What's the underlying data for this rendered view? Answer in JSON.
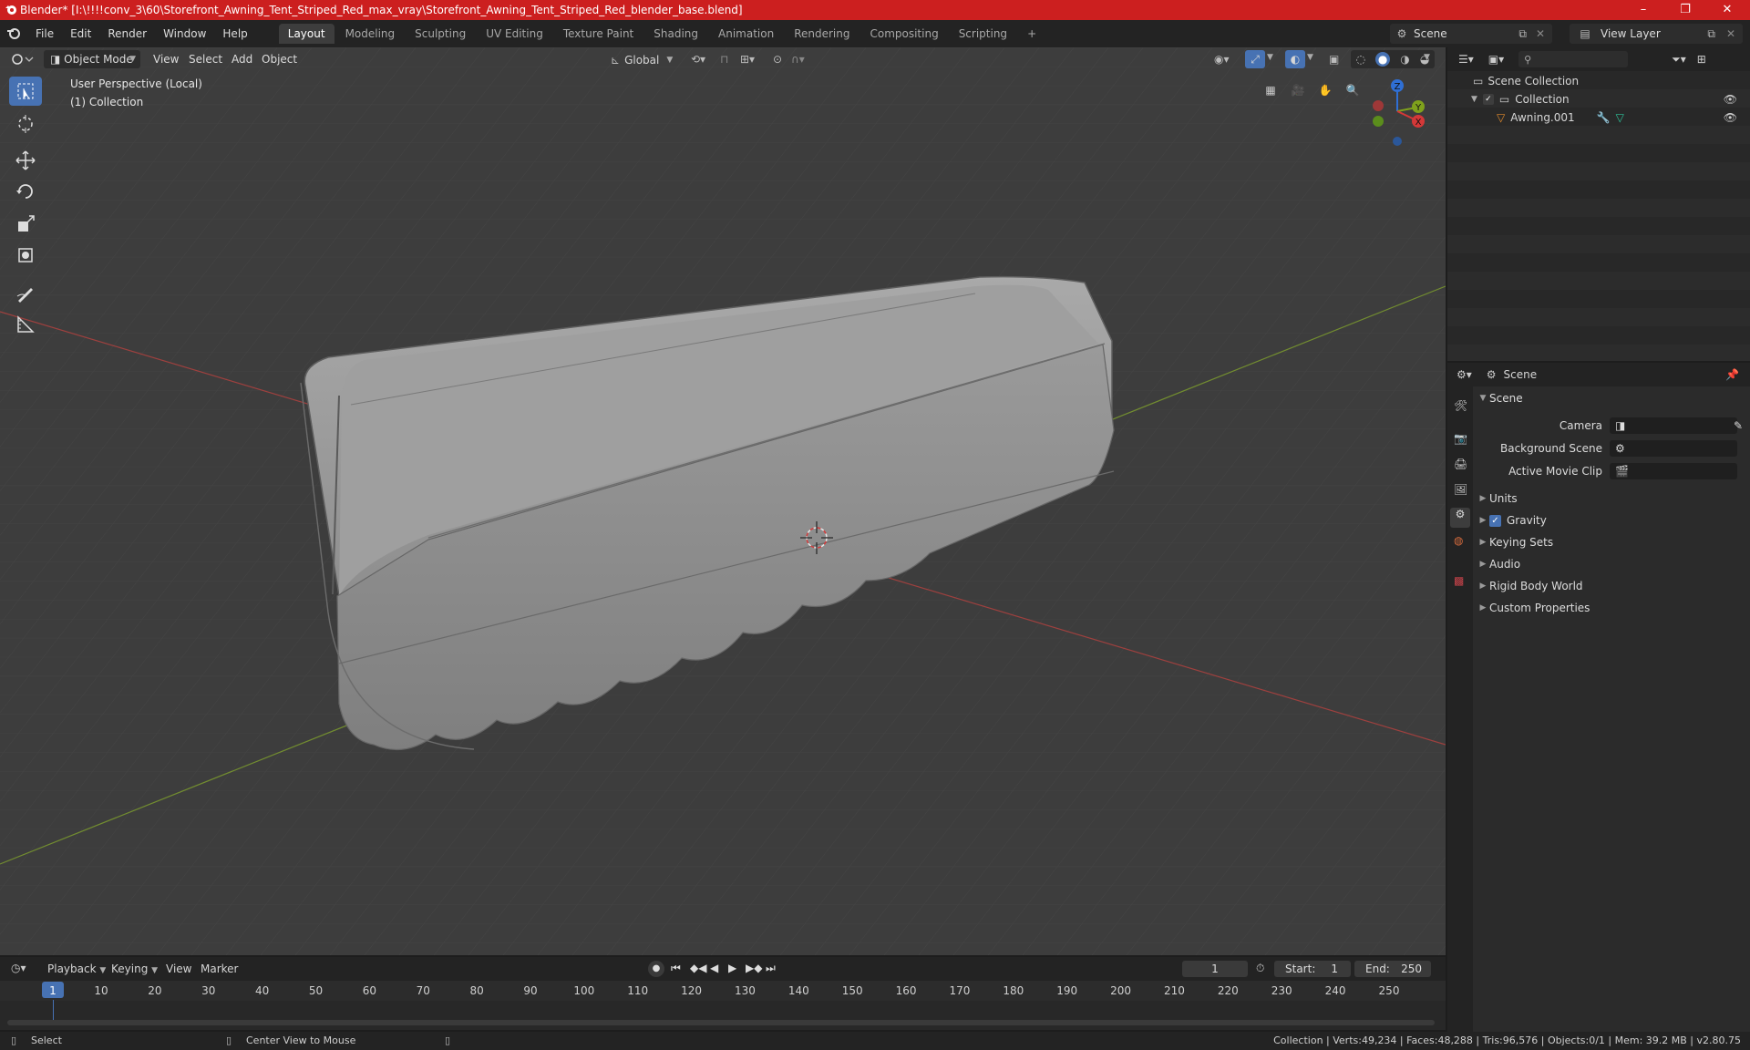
{
  "window": {
    "title": "Blender* [I:\\!!!!conv_3\\60\\Storefront_Awning_Tent_Striped_Red_max_vray\\Storefront_Awning_Tent_Striped_Red_blender_base.blend]",
    "minimize": "–",
    "maximize": "❐",
    "close": "✕"
  },
  "menu": [
    "File",
    "Edit",
    "Render",
    "Window",
    "Help"
  ],
  "workspaces": [
    "Layout",
    "Modeling",
    "Sculpting",
    "UV Editing",
    "Texture Paint",
    "Shading",
    "Animation",
    "Rendering",
    "Compositing",
    "Scripting"
  ],
  "workspace_add": "+",
  "scene_selector": {
    "label": "Scene"
  },
  "view_layer": {
    "label": "View Layer"
  },
  "viewport": {
    "mode": "Object Mode",
    "menus": [
      "View",
      "Select",
      "Add",
      "Object"
    ],
    "orientation": "Global",
    "overlay_line1": "User Perspective (Local)",
    "overlay_line2": "(1) Collection",
    "gizmo": {
      "z": "Z",
      "y": "Y",
      "x": "X"
    }
  },
  "outliner": {
    "root": "Scene Collection",
    "collection": "Collection",
    "object": "Awning.001"
  },
  "properties": {
    "header": "Scene",
    "panel_title": "Scene",
    "camera_label": "Camera",
    "background_scene_label": "Background Scene",
    "active_movie_clip_label": "Active Movie Clip",
    "panels": [
      "Units",
      "Gravity",
      "Keying Sets",
      "Audio",
      "Rigid Body World",
      "Custom Properties"
    ],
    "gravity_checked": true
  },
  "timeline": {
    "menus": [
      "Playback",
      "Keying",
      "View",
      "Marker"
    ],
    "current_frame": "1",
    "start_label": "Start:",
    "start": "1",
    "end_label": "End:",
    "end": "250",
    "ticks": [
      "1",
      "10",
      "20",
      "30",
      "40",
      "50",
      "60",
      "70",
      "80",
      "90",
      "100",
      "110",
      "120",
      "130",
      "140",
      "150",
      "160",
      "170",
      "180",
      "190",
      "200",
      "210",
      "220",
      "230",
      "240",
      "250"
    ]
  },
  "status": {
    "select": "Select",
    "center_view": "Center View to Mouse",
    "stats": "Collection | Verts:49,234 | Faces:48,288 | Tris:96,576 | Objects:0/1 | Mem: 39.2 MB | v2.80.75"
  },
  "colors": {
    "titlebar": "#cc1f1f",
    "active_tool": "#4772b3",
    "viewport_bg": "#3d3d3d",
    "x_axis": "#b0413f",
    "y_axis": "#7c9b2e",
    "frame_marker": "#4772b3"
  }
}
